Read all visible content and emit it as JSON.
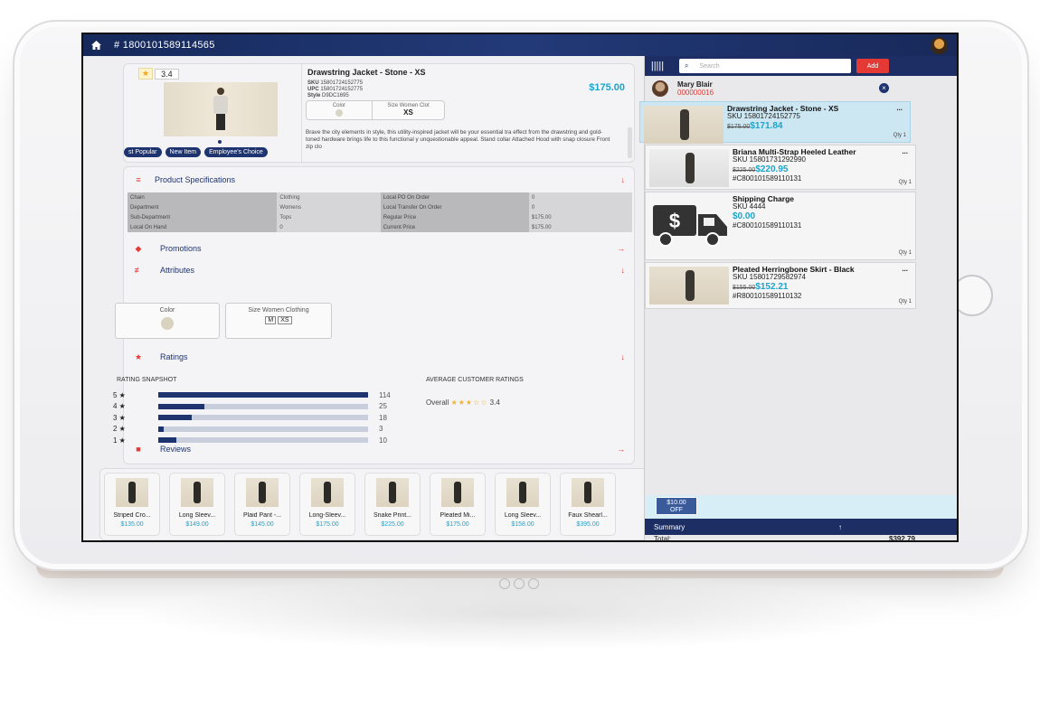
{
  "header": {
    "order_number": "# 1800101589114565"
  },
  "product": {
    "rating": "3.4",
    "title": "Drawstring Jacket - Stone - XS",
    "sku_label": "SKU",
    "sku": "15801724152775",
    "upc_label": "UPC",
    "upc": "15801724152775",
    "style_label": "Style",
    "style": "D9DC1695",
    "price": "$175.00",
    "color_label": "Color",
    "size_label": "Size Women Clot",
    "size_value": "XS",
    "description": "Brave the city elements in style, this utility-inspired jacket will be your essential tra effect from the drawstring and gold-toned hardware brings life to this functional y unquestionable appeal. Stand collar Attached Hood with snap closure Front zip clo",
    "badges": [
      "st Popular",
      "New Item",
      "Employee's Choice"
    ]
  },
  "specs": {
    "title": "Product Specifications",
    "rows": [
      [
        "Chain",
        "Clothing",
        "Local PO On Order",
        "0"
      ],
      [
        "Department",
        "Womens",
        "Local Transfer On Order",
        "0"
      ],
      [
        "Sub-Department",
        "Tops",
        "Regular Price",
        "$175.00"
      ],
      [
        "Local On Hand",
        "0",
        "Current Price",
        "$175.00"
      ]
    ]
  },
  "sections": {
    "promotions": "Promotions",
    "attributes": "Attributes",
    "ratings": "Ratings",
    "reviews": "Reviews"
  },
  "attributes": {
    "color_label": "Color",
    "size_label": "Size Women Clothing",
    "sizes": [
      "M",
      "XS"
    ]
  },
  "ratings": {
    "snapshot_title": "RATING SNAPSHOT",
    "average_title": "AVERAGE CUSTOMER RATINGS",
    "bars": [
      {
        "label": "5 ★",
        "count": 114
      },
      {
        "label": "4 ★",
        "count": 25
      },
      {
        "label": "3 ★",
        "count": 18
      },
      {
        "label": "2 ★",
        "count": 3
      },
      {
        "label": "1 ★",
        "count": 10
      }
    ],
    "overall_label": "Overall",
    "overall_stars": "★★★☆☆",
    "overall_value": "3.4"
  },
  "related": [
    {
      "name": "Striped Cro...",
      "price": "$135.00"
    },
    {
      "name": "Long Sleev...",
      "price": "$149.00"
    },
    {
      "name": "Plaid Pant -...",
      "price": "$145.00"
    },
    {
      "name": "Long-Sleev...",
      "price": "$175.00"
    },
    {
      "name": "Snake Print...",
      "price": "$225.00"
    },
    {
      "name": "Pleated Mi...",
      "price": "$175.00"
    },
    {
      "name": "Long Sleev...",
      "price": "$158.00"
    },
    {
      "name": "Faux Shearl...",
      "price": "$395.00"
    }
  ],
  "cart": {
    "search_placeholder": "Search",
    "add_label": "Add",
    "customer_name": "Mary Blair",
    "customer_id": "000000016",
    "items": [
      {
        "name": "Drawstring Jacket - Stone - XS",
        "sku": "SKU 15801724152775",
        "old": "$175.00",
        "new": "$171.84",
        "ref": "",
        "qty": "Qty 1"
      },
      {
        "name": "Briana Multi-Strap Heeled Leather",
        "sku": "SKU 15801731292990",
        "old": "$225.00",
        "new": "$220.95",
        "ref": "#C800101589110131",
        "qty": "Qty 1"
      },
      {
        "name": "Shipping Charge",
        "sku": "SKU 4444",
        "old": "",
        "new": "$0.00",
        "ref": "#C800101589110131",
        "qty": "Qty 1"
      },
      {
        "name": "Pleated Herringbone Skirt - Black",
        "sku": "SKU 15801729582974",
        "old": "$155.00",
        "new": "$152.21",
        "ref": "#R800101589110132",
        "qty": "Qty 1"
      }
    ],
    "discount_line1": "$10.00",
    "discount_line2": "OFF",
    "summary_label": "Summary",
    "total_label": "Total:",
    "total_value": "$392.79"
  }
}
